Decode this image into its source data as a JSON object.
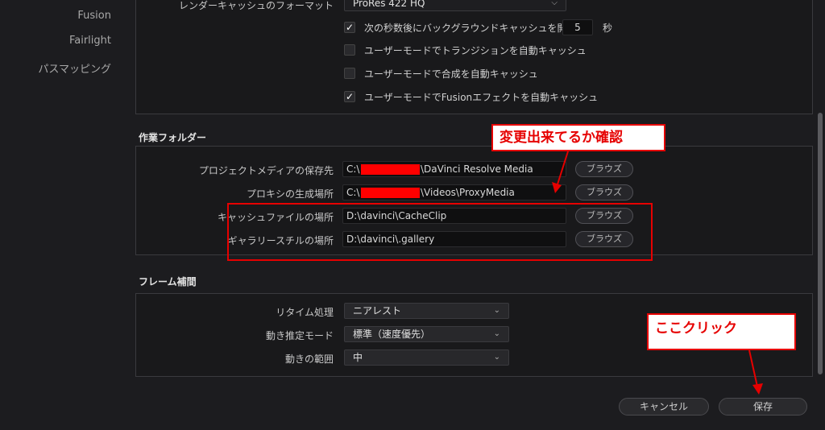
{
  "sidebar": {
    "items": [
      {
        "label": "Fusion"
      },
      {
        "label": "Fairlight"
      },
      {
        "label": "パスマッピング"
      }
    ]
  },
  "cache": {
    "format_label": "レンダーキャッシュのフォーマット",
    "format_value": "ProRes 422 HQ",
    "bg_cache_label": "次の秒数後にバックグラウンドキャッシュを開始",
    "bg_cache_seconds": "5",
    "bg_cache_unit": "秒",
    "options": [
      {
        "label": "次の秒数後にバックグラウンドキャッシュを開始",
        "checked": true
      },
      {
        "label": "ユーザーモードでトランジションを自動キャッシュ",
        "checked": false
      },
      {
        "label": "ユーザーモードで合成を自動キャッシュ",
        "checked": false
      },
      {
        "label": "ユーザーモードでFusionエフェクトを自動キャッシュ",
        "checked": true
      }
    ]
  },
  "working_folders": {
    "title": "作業フォルダー",
    "rows": [
      {
        "label": "プロジェクトメディアの保存先",
        "prefix": "C:\\",
        "suffix": "\\DaVinci Resolve Media",
        "browse": "ブラウズ"
      },
      {
        "label": "プロキシの生成場所",
        "prefix": "C:\\",
        "suffix": "\\Videos\\ProxyMedia",
        "browse": "ブラウズ"
      },
      {
        "label": "キャッシュファイルの場所",
        "value": "D:\\davinci\\CacheClip",
        "browse": "ブラウズ"
      },
      {
        "label": "ギャラリースチルの場所",
        "value": "D:\\davinci\\.gallery",
        "browse": "ブラウズ"
      }
    ]
  },
  "frame_interpolation": {
    "title": "フレーム補間",
    "rows": [
      {
        "label": "リタイム処理",
        "value": "ニアレスト"
      },
      {
        "label": "動き推定モード",
        "value": "標準（速度優先）"
      },
      {
        "label": "動きの範囲",
        "value": "中"
      }
    ]
  },
  "footer": {
    "cancel_label": "キャンセル",
    "save_label": "保存"
  },
  "annotations": {
    "check_callout": "変更出来てるか確認",
    "click_callout": "ここクリック"
  },
  "colors": {
    "annotation_red": "#e60000",
    "redaction": "#ff0000"
  }
}
